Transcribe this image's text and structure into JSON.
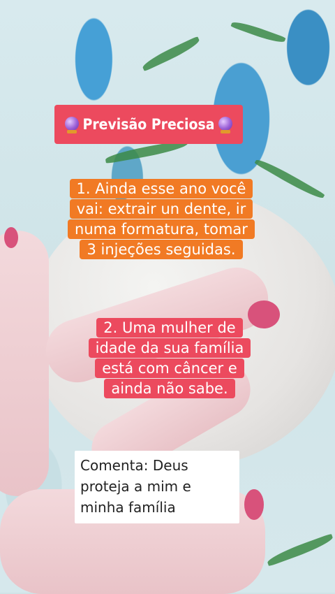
{
  "title": {
    "text": "Previsão Preciosa",
    "left_icon": "crystal-ball-icon",
    "right_icon": "crystal-ball-icon"
  },
  "prediction_1": "1. Ainda esse ano você vai: extrair un dente, ir numa formatura, tomar 3 injeções seguidas.",
  "prediction_2": "2. Uma mulher de idade da sua família está com câncer e ainda não sabe.",
  "comment": "Comenta: Deus proteja a mim e minha família",
  "colors": {
    "title_bg": "#ec4a5e",
    "prediction_1_bg": "#f17a24",
    "prediction_2_bg": "#ec4a5e",
    "comment_bg": "#ffffff"
  }
}
